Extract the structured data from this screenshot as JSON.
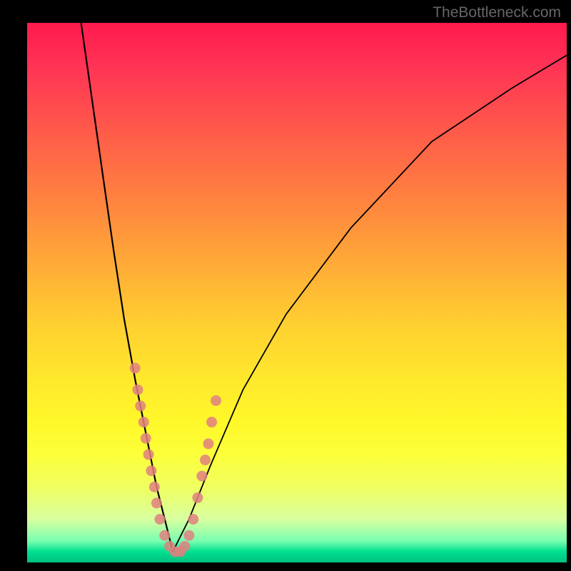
{
  "watermark": "TheBottleneck.com",
  "chart_data": {
    "type": "line",
    "title": "",
    "xlabel": "",
    "ylabel": "",
    "xlim": [
      0,
      100
    ],
    "ylim": [
      0,
      100
    ],
    "description": "V-shaped bottleneck curve with minimum near x=27, over vertical gradient background from red (top/high bottleneck) to green (bottom/low bottleneck). Pink dot markers cluster near the valley.",
    "curve_left": {
      "x": [
        10,
        12,
        14,
        16,
        18,
        20,
        22,
        24,
        26,
        27
      ],
      "y": [
        100,
        86,
        72,
        58,
        45,
        34,
        24,
        14,
        6,
        2
      ]
    },
    "curve_right": {
      "x": [
        27,
        30,
        34,
        40,
        48,
        60,
        75,
        90,
        100
      ],
      "y": [
        2,
        8,
        18,
        32,
        46,
        62,
        78,
        88,
        94
      ]
    },
    "markers_left": {
      "x_range": [
        20,
        27
      ],
      "y_range": [
        4,
        36
      ],
      "points": [
        [
          20.0,
          36
        ],
        [
          20.5,
          32
        ],
        [
          21.0,
          29
        ],
        [
          21.6,
          26
        ],
        [
          22.0,
          23
        ],
        [
          22.5,
          20
        ],
        [
          23.0,
          17
        ],
        [
          23.6,
          14
        ],
        [
          24.0,
          11
        ],
        [
          24.6,
          8
        ],
        [
          25.5,
          5
        ],
        [
          26.4,
          3
        ],
        [
          27.4,
          2
        ],
        [
          28.4,
          2
        ]
      ]
    },
    "markers_right": {
      "x_range": [
        29,
        35
      ],
      "y_range": [
        4,
        30
      ],
      "points": [
        [
          29.2,
          3
        ],
        [
          30.0,
          5
        ],
        [
          30.8,
          8
        ],
        [
          31.6,
          12
        ],
        [
          32.4,
          16
        ],
        [
          33.0,
          19
        ],
        [
          33.6,
          22
        ],
        [
          34.2,
          26
        ],
        [
          35.0,
          30
        ]
      ]
    },
    "gradient_stops": [
      {
        "pos": 0,
        "color": "#ff1a4d"
      },
      {
        "pos": 50,
        "color": "#ffd030"
      },
      {
        "pos": 80,
        "color": "#fcff3a"
      },
      {
        "pos": 100,
        "color": "#00c080"
      }
    ]
  }
}
